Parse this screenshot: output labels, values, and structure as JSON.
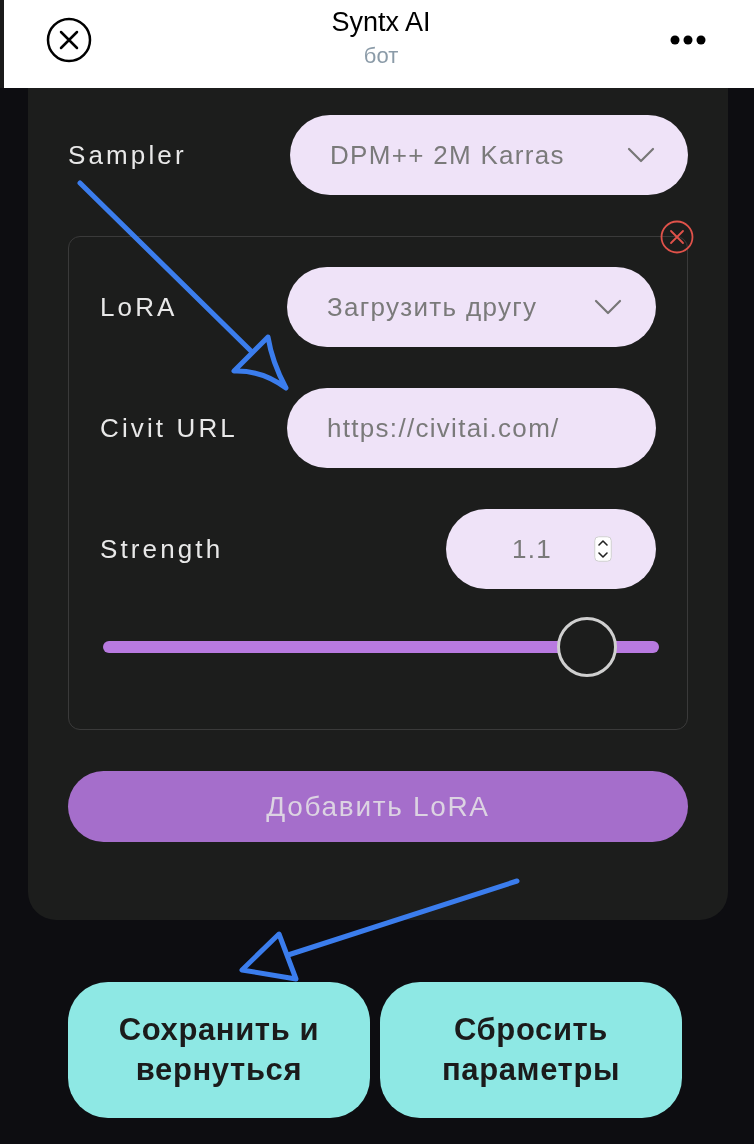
{
  "header": {
    "title": "Syntx AI",
    "subtitle": "бот"
  },
  "sampler": {
    "label": "Sampler",
    "value": "DPM++ 2M Karras"
  },
  "lora_panels": [
    {
      "fields": [
        {
          "kind": "select",
          "label": "LoRA",
          "value": "Загрузить другу"
        },
        {
          "kind": "text",
          "label": "Civit URL",
          "value": "https://civitai.com/"
        },
        {
          "kind": "number",
          "label": "Strength",
          "value": "1.1"
        }
      ],
      "slider": {
        "level": 0.87
      }
    }
  ],
  "add_button": {
    "label": "Добавить LoRA"
  },
  "buttons": [
    {
      "label": "Сохранить и вернуться"
    },
    {
      "label": "Сбросить параметры"
    }
  ]
}
